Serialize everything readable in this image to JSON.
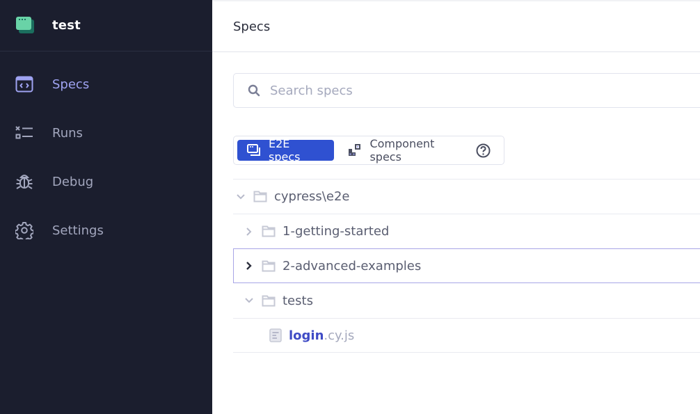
{
  "app": {
    "title": "test",
    "logo_icon": "app-window-icon"
  },
  "sidebar": {
    "items": [
      {
        "label": "Specs",
        "icon": "code-window-icon",
        "active": true
      },
      {
        "label": "Runs",
        "icon": "runs-list-icon",
        "active": false
      },
      {
        "label": "Debug",
        "icon": "bug-icon",
        "active": false
      },
      {
        "label": "Settings",
        "icon": "gear-icon",
        "active": false
      }
    ]
  },
  "header": {
    "title": "Specs"
  },
  "search": {
    "placeholder": "Search specs",
    "value": ""
  },
  "testing_type_toggle": {
    "options": [
      {
        "label": "E2E specs",
        "icon": "e2e-window-icon",
        "selected": true
      },
      {
        "label": "Component specs",
        "icon": "component-blocks-icon",
        "selected": false
      }
    ],
    "help_icon": "question-circle-icon"
  },
  "spec_tree": [
    {
      "type": "folder",
      "name": "cypress\\e2e",
      "expanded": true,
      "depth": 0
    },
    {
      "type": "folder",
      "name": "1-getting-started",
      "expanded": false,
      "depth": 1
    },
    {
      "type": "folder",
      "name": "2-advanced-examples",
      "expanded": false,
      "depth": 1,
      "focused": true
    },
    {
      "type": "folder",
      "name": "tests",
      "expanded": true,
      "depth": 1
    },
    {
      "type": "file",
      "name": "login",
      "extension": ".cy.js",
      "depth": 2
    }
  ],
  "colors": {
    "sidebar_bg": "#1b1e2e",
    "active_nav": "#9fa3f1",
    "primary_button": "#2f51d1",
    "file_link": "#3f4bc5",
    "logo_green": "#69d3a7"
  }
}
